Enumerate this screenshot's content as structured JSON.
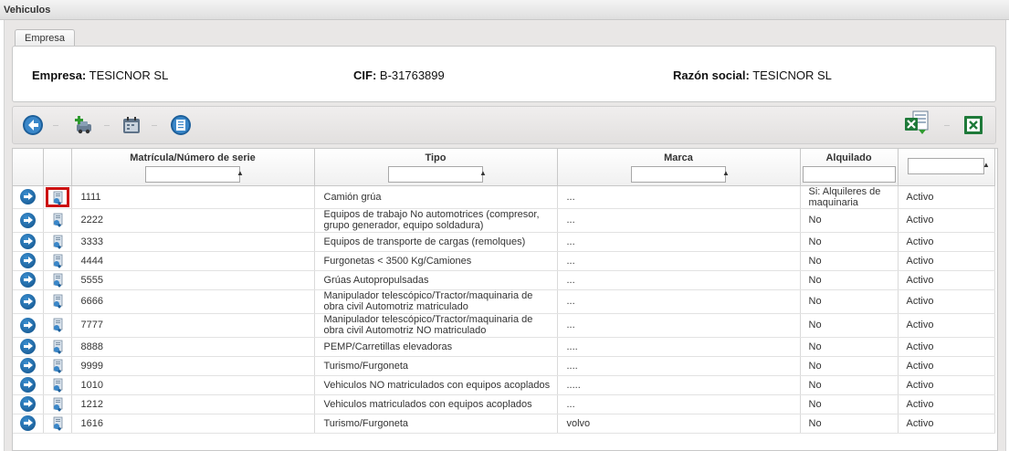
{
  "window": {
    "title": "Vehiculos"
  },
  "tabs": [
    {
      "label": "Empresa"
    }
  ],
  "company": {
    "empresa_label": "Empresa:",
    "empresa_value": "TESICNOR SL",
    "cif_label": "CIF:",
    "cif_value": "B-31763899",
    "razon_label": "Razón social:",
    "razon_value": "TESICNOR SL"
  },
  "toolbar": {
    "icons": [
      "back-icon",
      "add-vehicle-icon",
      "calendar-icon",
      "list-icon",
      "export-excel-icon",
      "excel-icon"
    ]
  },
  "grid": {
    "columns": [
      "",
      "",
      "Matrícula/Número de serie",
      "Tipo",
      "Marca",
      "Alquilado",
      ""
    ],
    "rows": [
      {
        "matricula": "1111",
        "tipo": "Camión grúa",
        "marca": "...",
        "alquilado": "Si: Alquileres de maquinaria",
        "estado": "Activo"
      },
      {
        "matricula": "2222",
        "tipo": "Equipos de trabajo No automotrices (compresor, grupo generador, equipo soldadura)",
        "marca": "...",
        "alquilado": "No",
        "estado": "Activo"
      },
      {
        "matricula": "3333",
        "tipo": "Equipos de transporte de cargas (remolques)",
        "marca": "...",
        "alquilado": "No",
        "estado": "Activo"
      },
      {
        "matricula": "4444",
        "tipo": "Furgonetas < 3500 Kg/Camiones",
        "marca": "...",
        "alquilado": "No",
        "estado": "Activo"
      },
      {
        "matricula": "5555",
        "tipo": "Grúas Autopropulsadas",
        "marca": "...",
        "alquilado": "No",
        "estado": "Activo"
      },
      {
        "matricula": "6666",
        "tipo": "Manipulador telescópico/Tractor/maquinaria de obra civil Automotriz matriculado",
        "marca": "...",
        "alquilado": "No",
        "estado": "Activo"
      },
      {
        "matricula": "7777",
        "tipo": "Manipulador telescópico/Tractor/maquinaria de obra civil Automotriz NO matriculado",
        "marca": "...",
        "alquilado": "No",
        "estado": "Activo"
      },
      {
        "matricula": "8888",
        "tipo": "PEMP/Carretillas elevadoras",
        "marca": "....",
        "alquilado": "No",
        "estado": "Activo"
      },
      {
        "matricula": "9999",
        "tipo": "Turismo/Furgoneta",
        "marca": "....",
        "alquilado": "No",
        "estado": "Activo"
      },
      {
        "matricula": "1010",
        "tipo": "Vehiculos NO matriculados con equipos acoplados",
        "marca": ".....",
        "alquilado": "No",
        "estado": "Activo"
      },
      {
        "matricula": "1212",
        "tipo": "Vehiculos matriculados con equipos acoplados",
        "marca": "...",
        "alquilado": "No",
        "estado": "Activo"
      },
      {
        "matricula": "1616",
        "tipo": "Turismo/Furgoneta",
        "marca": "volvo",
        "alquilado": "No",
        "estado": "Activo"
      }
    ]
  }
}
